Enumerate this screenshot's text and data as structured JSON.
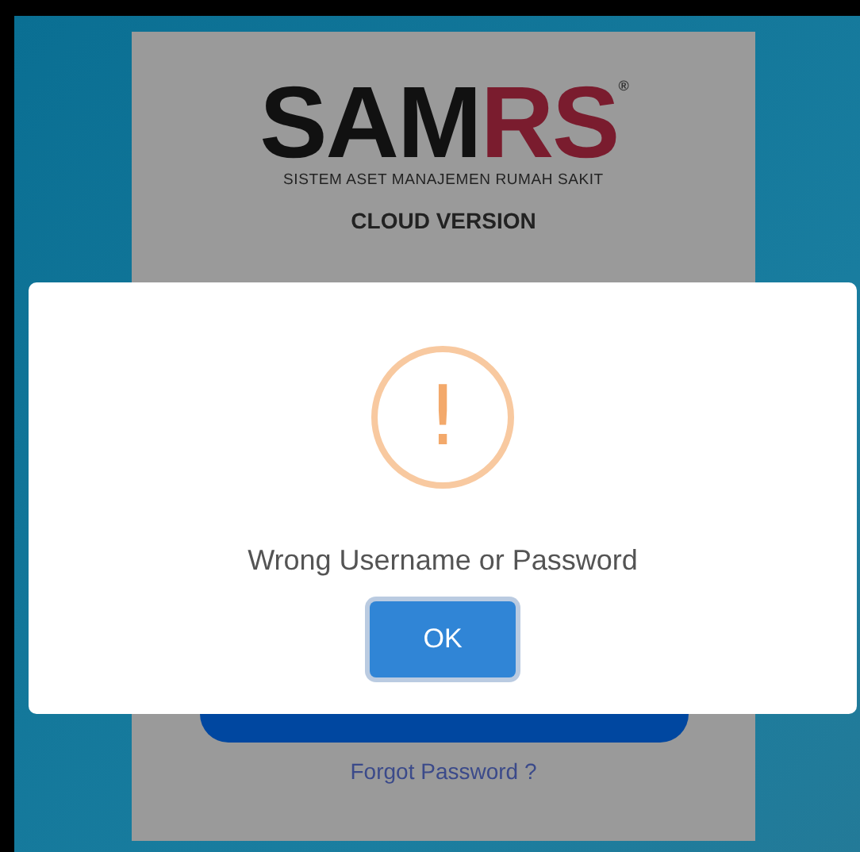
{
  "login_card": {
    "logo": {
      "part_1": "SAM",
      "part_2": "RS",
      "mark": "®",
      "tagline": "SISTEM ASET MANAJEMEN RUMAH SAKIT"
    },
    "subtitle": "CLOUD VERSION",
    "forgot_link": "Forgot Password ?"
  },
  "alert": {
    "kind": "warning",
    "icon_text": "!",
    "message": "Wrong Username or Password",
    "button": "OK"
  }
}
